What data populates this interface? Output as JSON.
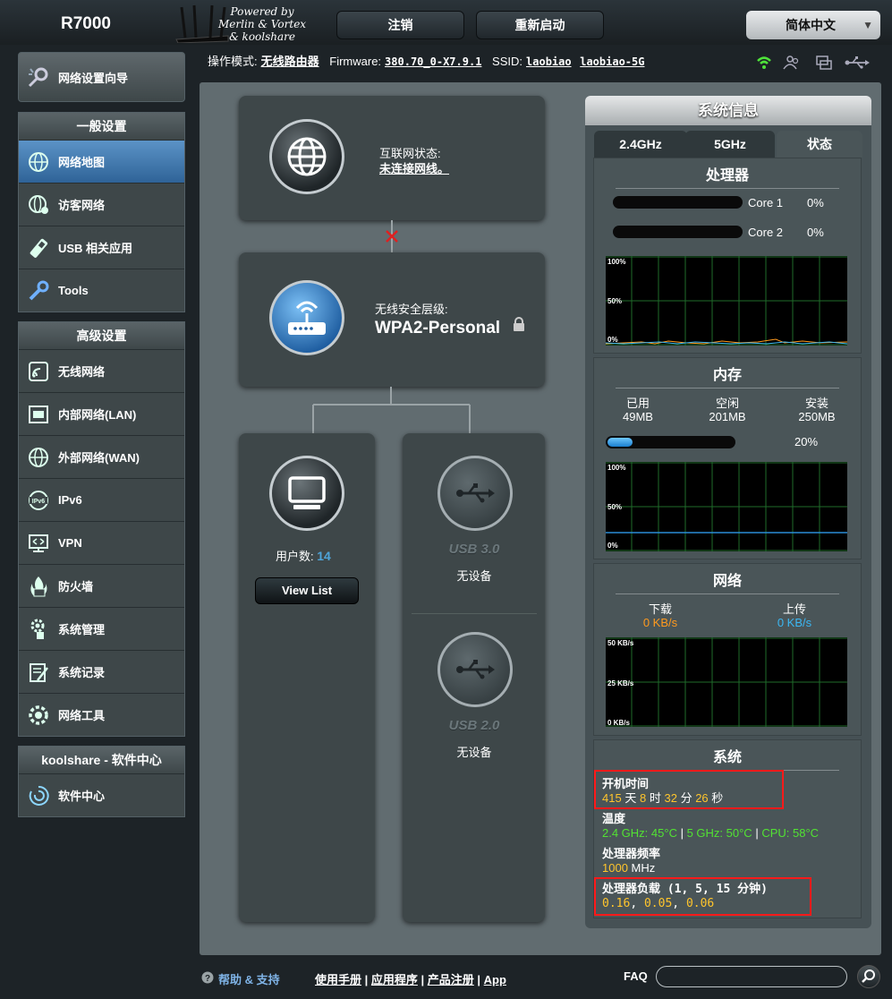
{
  "header": {
    "model": "R7000",
    "logo_line1": "Powered by",
    "logo_line2": "Merlin & Vortex",
    "logo_line3": "& koolshare",
    "logout": "注销",
    "reboot": "重新启动",
    "language": "简体中文"
  },
  "status": {
    "mode_label": "操作模式:",
    "mode_value": "无线路由器",
    "fw_label": "Firmware:",
    "fw_value": "380.70_0-X7.9.1",
    "ssid_label": "SSID:",
    "ssid_1": "laobiao",
    "ssid_2": "laobiao-5G"
  },
  "sidebar": {
    "quick": "网络设置向导",
    "general_title": "一般设置",
    "general": [
      {
        "label": "网络地图"
      },
      {
        "label": "访客网络"
      },
      {
        "label": "USB 相关应用"
      },
      {
        "label": "Tools"
      }
    ],
    "advanced_title": "高级设置",
    "advanced": [
      {
        "label": "无线网络"
      },
      {
        "label": "内部网络(LAN)"
      },
      {
        "label": "外部网络(WAN)"
      },
      {
        "label": "IPv6"
      },
      {
        "label": "VPN"
      },
      {
        "label": "防火墙"
      },
      {
        "label": "系统管理"
      },
      {
        "label": "系统记录"
      },
      {
        "label": "网络工具"
      }
    ],
    "kool_title": "koolshare - 软件中心",
    "kool": [
      {
        "label": "软件中心"
      }
    ]
  },
  "map": {
    "internet_label": "互联网状态:",
    "internet_value": "未连接网线。",
    "wireless_label": "无线安全层级:",
    "wireless_value": "WPA2-Personal",
    "clients_label": "用户数:",
    "clients_count": "14",
    "view_list": "View List",
    "usb3": "USB 3.0",
    "usb3_status": "无设备",
    "usb2": "USB 2.0",
    "usb2_status": "无设备"
  },
  "sysinfo": {
    "title": "系统信息",
    "tabs": [
      "2.4GHz",
      "5GHz",
      "状态"
    ],
    "cpu_title": "处理器",
    "cores": [
      {
        "name": "Core 1",
        "value": "0%"
      },
      {
        "name": "Core 2",
        "value": "0%"
      }
    ],
    "pct_100": "100%",
    "pct_50": "50%",
    "pct_0": "0%",
    "mem_title": "内存",
    "mem_used_label": "已用",
    "mem_used": "49MB",
    "mem_free_label": "空闲",
    "mem_free": "201MB",
    "mem_total_label": "安装",
    "mem_total": "250MB",
    "mem_pct": "20%",
    "mem_fraction": 0.2,
    "net_title": "网络",
    "down_label": "下载",
    "down_value": "0 KB/s",
    "up_label": "上传",
    "up_value": "0 KB/s",
    "net_50": "50 KB/s",
    "net_25": "25 KB/s",
    "net_0": "0 KB/s",
    "sys_title": "系统",
    "uptime_label": "开机时间",
    "uptime_days": "415",
    "uptime_d": "天",
    "uptime_hours": "8",
    "uptime_h": "时",
    "uptime_min": "32",
    "uptime_m": "分",
    "uptime_sec": "26",
    "uptime_s": "秒",
    "temp_label": "温度",
    "temp_24": "2.4 GHz: 45°C",
    "temp_5": "5 GHz: 50°C",
    "temp_cpu": "CPU: 58°C",
    "freq_label": "处理器频率",
    "freq_value": "1000",
    "freq_unit": "MHz",
    "load_label": "处理器负载 (1, 5, 15 分钟)",
    "load_1": "0.16",
    "load_5": "0.05",
    "load_15": "0.06"
  },
  "footer": {
    "help": "帮助 & 支持",
    "manual": "使用手册",
    "apps": "应用程序",
    "register": "产品注册",
    "app": "App",
    "faq": "FAQ"
  }
}
